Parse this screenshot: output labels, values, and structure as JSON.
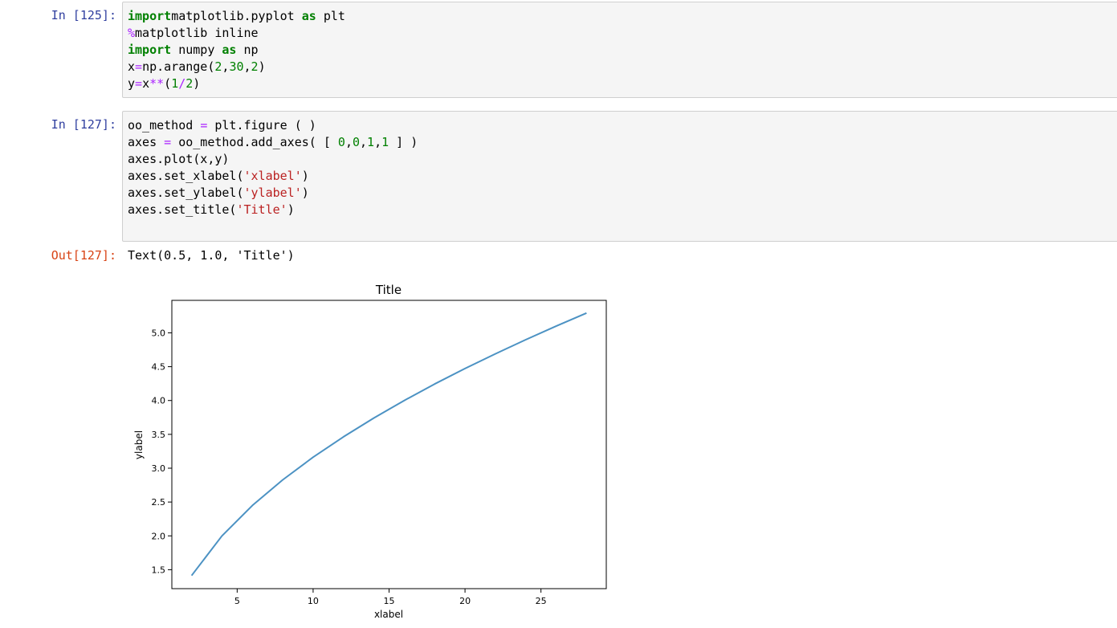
{
  "cells": [
    {
      "prompt": "In [125]:",
      "lines": [
        [
          [
            "kw",
            "import"
          ],
          [
            "",
            "matplotlib.pyplot "
          ],
          [
            "kw",
            "as"
          ],
          [
            "",
            " plt"
          ]
        ],
        [
          [
            "mg",
            "%"
          ],
          [
            "",
            "matplotlib inline"
          ]
        ],
        [
          [
            "kw",
            "import"
          ],
          [
            "",
            " numpy "
          ],
          [
            "kw",
            "as"
          ],
          [
            "",
            " np"
          ]
        ],
        [
          [
            "",
            "x"
          ],
          [
            "op",
            "="
          ],
          [
            "",
            "np.arange("
          ],
          [
            "nm",
            "2"
          ],
          [
            "",
            ","
          ],
          [
            "nm",
            "30"
          ],
          [
            "",
            ","
          ],
          [
            "nm",
            "2"
          ],
          [
            "",
            ")"
          ]
        ],
        [
          [
            "",
            "y"
          ],
          [
            "op",
            "="
          ],
          [
            "",
            "x"
          ],
          [
            "op",
            "**"
          ],
          [
            "",
            "("
          ],
          [
            "nm",
            "1"
          ],
          [
            "op",
            "/"
          ],
          [
            "nm",
            "2"
          ],
          [
            "",
            ")"
          ]
        ]
      ]
    },
    {
      "prompt": "In [127]:",
      "lines": [
        [
          [
            "",
            "oo_method "
          ],
          [
            "op",
            "="
          ],
          [
            "",
            " plt.figure ( )"
          ]
        ],
        [
          [
            "",
            "axes "
          ],
          [
            "op",
            "="
          ],
          [
            "",
            " oo_method.add_axes( [ "
          ],
          [
            "nm",
            "0"
          ],
          [
            "",
            ","
          ],
          [
            "nm",
            "0"
          ],
          [
            "",
            ","
          ],
          [
            "nm",
            "1"
          ],
          [
            "",
            ","
          ],
          [
            "nm",
            "1"
          ],
          [
            "",
            " ] )"
          ]
        ],
        [
          [
            "",
            "axes.plot(x,y)"
          ]
        ],
        [
          [
            "",
            "axes.set_xlabel("
          ],
          [
            "st",
            "'xlabel'"
          ],
          [
            "",
            ")"
          ]
        ],
        [
          [
            "",
            "axes.set_ylabel("
          ],
          [
            "st",
            "'ylabel'"
          ],
          [
            "",
            ")"
          ]
        ],
        [
          [
            "",
            "axes.set_title("
          ],
          [
            "st",
            "'Title'"
          ],
          [
            "",
            ")"
          ]
        ]
      ]
    }
  ],
  "output": {
    "prompt": "Out[127]:",
    "text": "Text(0.5, 1.0, 'Title')"
  },
  "chart_data": {
    "type": "line",
    "title": "Title",
    "xlabel": "xlabel",
    "ylabel": "ylabel",
    "x": [
      2,
      4,
      6,
      8,
      10,
      12,
      14,
      16,
      18,
      20,
      22,
      24,
      26,
      28
    ],
    "series": [
      {
        "values": [
          1.414,
          2.0,
          2.449,
          2.828,
          3.162,
          3.464,
          3.742,
          4.0,
          4.243,
          4.472,
          4.69,
          4.899,
          5.099,
          5.292
        ]
      }
    ],
    "xlim": [
      0.7,
      29.3
    ],
    "ylim": [
      1.22,
      5.48
    ],
    "xticks": [
      5,
      10,
      15,
      20,
      25
    ],
    "yticks": [
      1.5,
      2.0,
      2.5,
      3.0,
      3.5,
      4.0,
      4.5,
      5.0
    ],
    "grid": false,
    "line_color": "#4c92c3"
  }
}
